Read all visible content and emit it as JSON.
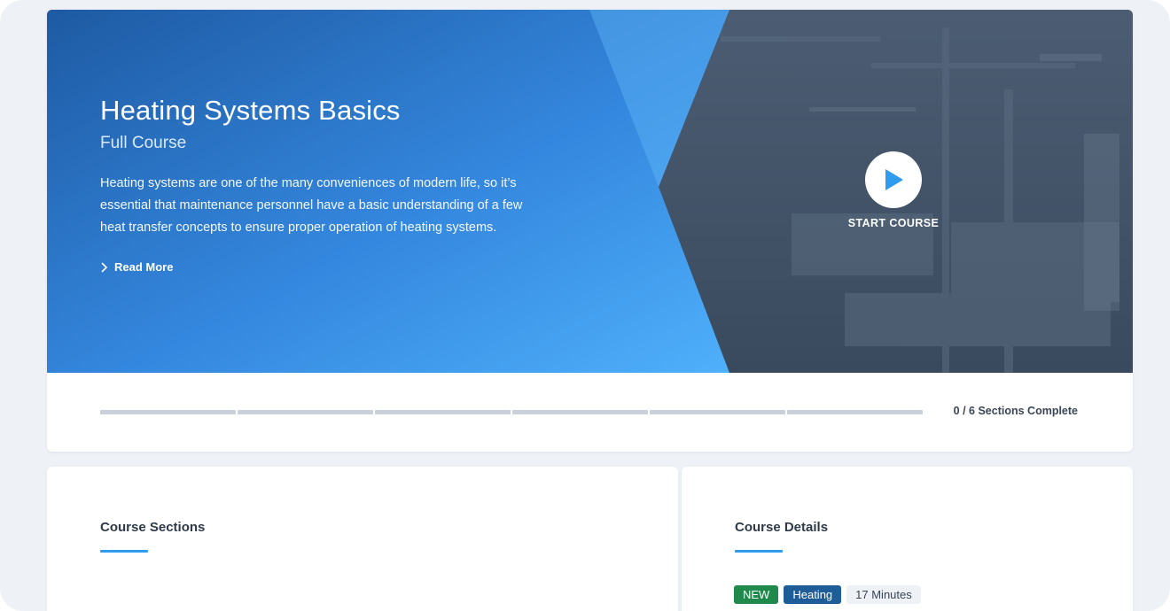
{
  "course": {
    "title": "Heating Systems Basics",
    "subtitle": "Full Course",
    "description": "Heating systems are one of the many conveniences of modern life, so it’s essential that maintenance personnel have a basic understanding of a few heat transfer concepts to ensure proper operation of heating systems.",
    "read_more_label": "Read More",
    "start_label": "START COURSE"
  },
  "progress": {
    "completed_sections": 0,
    "total_sections": 6,
    "label": "0 / 6 Sections Complete"
  },
  "sections_panel": {
    "title": "Course Sections"
  },
  "details_panel": {
    "title": "Course Details",
    "tags": {
      "new": "NEW",
      "topic": "Heating",
      "duration": "17 Minutes"
    }
  },
  "colors": {
    "accent": "#2f9cf0",
    "hero_blue_dark": "#1f5fa8",
    "hero_blue_light": "#4aa9f7",
    "tag_new": "#1f8a4c",
    "tag_topic": "#1e5d97"
  },
  "icons": {
    "read_more": "chevron-right-icon",
    "start": "play-icon"
  }
}
